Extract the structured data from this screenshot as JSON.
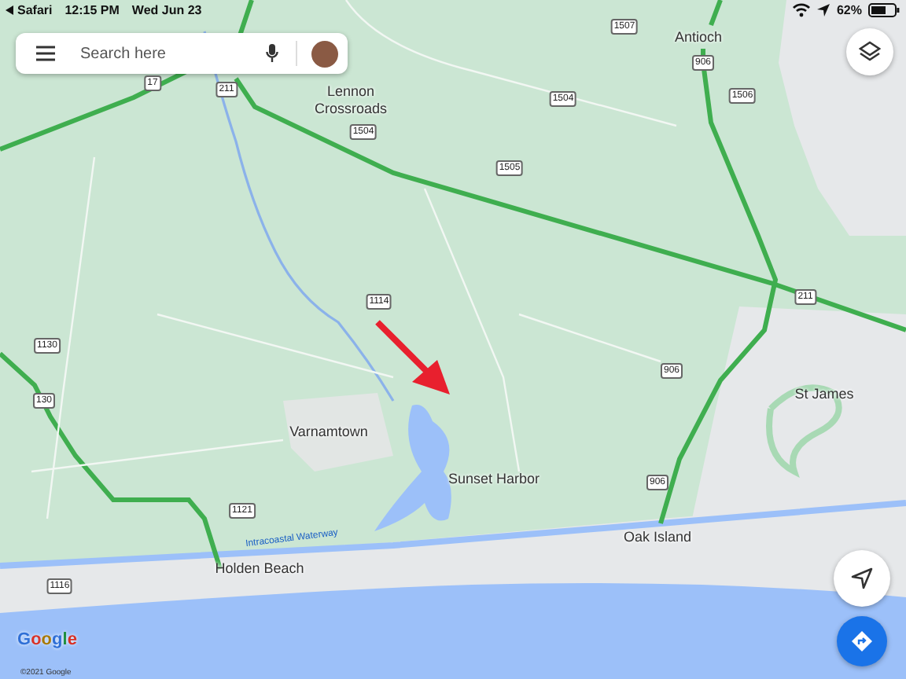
{
  "status_bar": {
    "back_app": "Safari",
    "time": "12:15 PM",
    "date": "Wed Jun 23",
    "battery": "62%"
  },
  "search": {
    "placeholder": "Search here"
  },
  "map": {
    "places": [
      {
        "name": "Antioch"
      },
      {
        "name": "Lennon\nCrossroads"
      },
      {
        "name": "Varnamtown"
      },
      {
        "name": "Sunset Harbor"
      },
      {
        "name": "St James"
      },
      {
        "name": "Oak Island"
      },
      {
        "name": "Holden Beach"
      }
    ],
    "waterway": "Intracoastal Waterway",
    "route_shields": [
      {
        "label": "1507"
      },
      {
        "label": "906"
      },
      {
        "label": "1504"
      },
      {
        "label": "1506"
      },
      {
        "label": "17"
      },
      {
        "label": "211"
      },
      {
        "label": "1504"
      },
      {
        "label": "1505"
      },
      {
        "label": "1114"
      },
      {
        "label": "211"
      },
      {
        "label": "1130"
      },
      {
        "label": "130"
      },
      {
        "label": "906"
      },
      {
        "label": "906"
      },
      {
        "label": "1121"
      },
      {
        "label": "1116"
      }
    ]
  },
  "attribution": {
    "logo": "Google",
    "copyright": "©2021 Google"
  }
}
